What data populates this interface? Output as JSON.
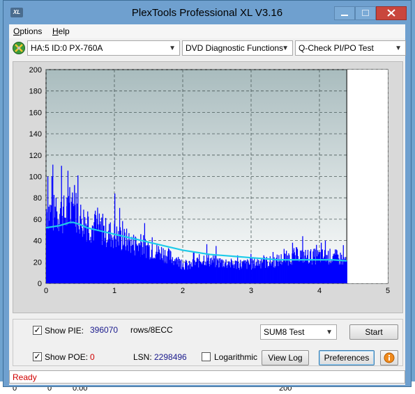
{
  "window": {
    "title": "PlexTools Professional XL V3.16",
    "logo_text": "XL"
  },
  "menu": {
    "items": [
      {
        "label": "Options",
        "mnemonic": "O",
        "rest": "ptions"
      },
      {
        "label": "Help",
        "mnemonic": "H",
        "rest": "elp"
      }
    ]
  },
  "toolbar": {
    "drive": "HA:5 ID:0  PX-760A",
    "function": "DVD Diagnostic Functions",
    "test": "Q-Check PI/PO Test"
  },
  "chart_data": {
    "type": "area",
    "xlim": [
      0,
      5
    ],
    "ylim": [
      0,
      200
    ],
    "x_ticks": [
      "0",
      "1",
      "2",
      "3",
      "4",
      "5"
    ],
    "y_ticks": [
      "0",
      "20",
      "40",
      "60",
      "80",
      "100",
      "120",
      "140",
      "160",
      "180",
      "200"
    ],
    "grid": true,
    "data_end_x": 4.4,
    "colors": {
      "bars": "#0000ff",
      "trend": "#1ecbe9",
      "plot_bg_top": "#a9bcbe",
      "plot_bg_bottom": "#ffffff"
    },
    "series": [
      {
        "type": "bar-envelope",
        "x": [
          0.0,
          0.1,
          0.2,
          0.3,
          0.4,
          0.5,
          0.6,
          0.7,
          0.8,
          0.9,
          1.0,
          1.1,
          1.2,
          1.3,
          1.4,
          1.5,
          1.6,
          1.7,
          1.8,
          1.9,
          2.0,
          2.1,
          2.2,
          2.3,
          2.4,
          2.5,
          2.6,
          2.7,
          2.8,
          2.9,
          3.0,
          3.1,
          3.2,
          3.3,
          3.4,
          3.5,
          3.6,
          3.7,
          3.8,
          3.9,
          4.0,
          4.1,
          4.2,
          4.3,
          4.4
        ],
        "values": [
          78,
          72,
          74,
          70,
          80,
          68,
          62,
          58,
          56,
          52,
          50,
          46,
          44,
          40,
          40,
          36,
          34,
          32,
          28,
          24,
          20,
          18,
          22,
          26,
          24,
          22,
          22,
          20,
          20,
          20,
          20,
          22,
          22,
          22,
          24,
          26,
          28,
          30,
          28,
          28,
          28,
          28,
          28,
          26,
          24
        ]
      },
      {
        "type": "spikes",
        "x": [
          0.02,
          0.08,
          0.14,
          0.22,
          0.3,
          0.34,
          0.38,
          0.41,
          0.46,
          1.0,
          1.38,
          2.15,
          3.6,
          3.95,
          4.02,
          4.08
        ],
        "values": [
          100,
          100,
          80,
          110,
          80,
          90,
          85,
          92,
          101,
          84,
          46,
          30,
          38,
          36,
          38,
          40
        ]
      },
      {
        "type": "trend-line",
        "x": [
          0.0,
          0.1,
          0.2,
          0.3,
          0.35,
          0.4,
          0.5,
          0.6,
          0.8,
          1.0,
          1.2,
          1.4,
          1.6,
          1.8,
          2.0,
          2.2,
          2.4,
          2.6,
          2.8,
          3.0,
          3.2,
          3.4,
          3.6,
          3.8,
          4.0,
          4.2,
          4.4
        ],
        "values": [
          52,
          53,
          54,
          56,
          57,
          57,
          55,
          52,
          49,
          46,
          43,
          40,
          37,
          34,
          31,
          29,
          27,
          26,
          25,
          24,
          23,
          22,
          22,
          22,
          22,
          22,
          21
        ]
      }
    ]
  },
  "controls": {
    "show_pie_label": "Show PIE:",
    "show_pie_mnemonic": "E",
    "show_pie_checked": true,
    "pie_value": "396070",
    "rows_label": "rows/8ECC",
    "show_poe_label": "Show POE:",
    "show_poe_checked": true,
    "poe_value": "0",
    "lsn_label": "LSN:",
    "lsn_value": "2298496",
    "logarithmic_label": "Logarithmic",
    "logarithmic_checked": false,
    "sum_select": "SUM8 Test",
    "start_button": "Start",
    "view_log_button": "View Log",
    "preferences_button": "Preferences",
    "info_icon": "info-icon"
  },
  "status": {
    "text": "Ready"
  },
  "background": {
    "row_values": [
      "0",
      "0",
      "0.00"
    ],
    "corner_value": "200"
  }
}
